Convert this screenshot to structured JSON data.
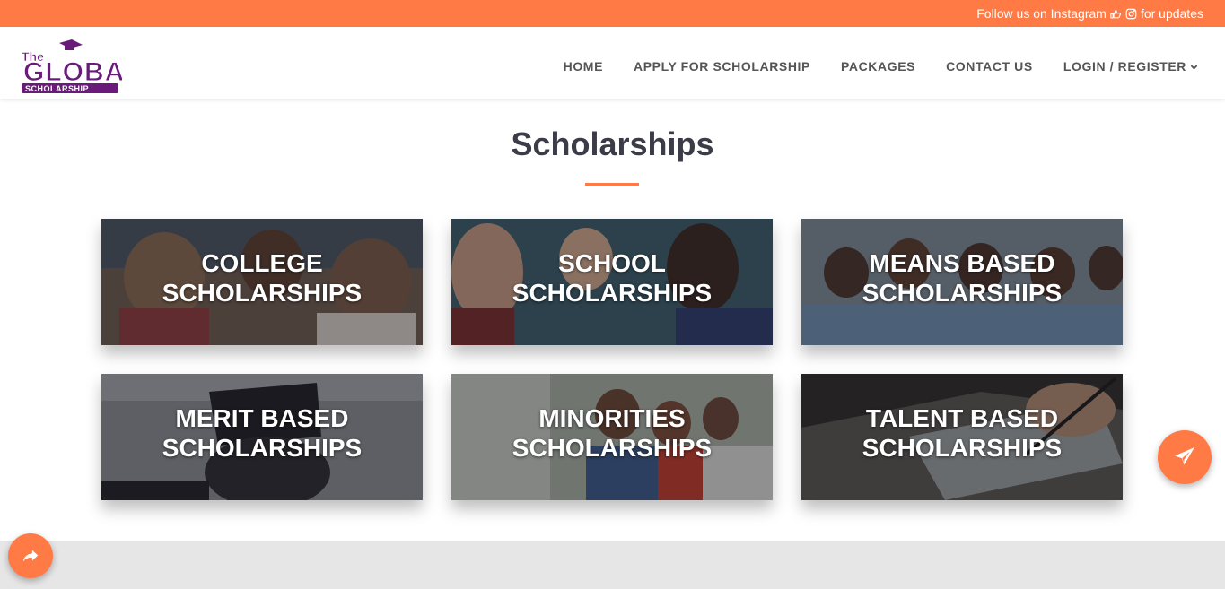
{
  "topbar": {
    "prefix": "Follow us on Instagram",
    "suffix": "for updates",
    "icons": [
      "hand-pointing-icon",
      "instagram-icon"
    ]
  },
  "brand": {
    "logo_icon": "the-global-scholarship-logo",
    "logo_text_line1": "The",
    "logo_text_line2": "GLOBAL",
    "logo_text_line3": "SCHOLARSHIP"
  },
  "nav": {
    "items": [
      {
        "label": "HOME"
      },
      {
        "label": "APPLY FOR SCHOLARSHIP"
      },
      {
        "label": "PACKAGES"
      },
      {
        "label": "CONTACT US"
      },
      {
        "label": "LOGIN / REGISTER",
        "icon": "chevron-down-icon"
      }
    ]
  },
  "main": {
    "title": "Scholarships",
    "cards": [
      {
        "line1": "COLLEGE",
        "line2": "SCHOLARSHIPS"
      },
      {
        "line1": "SCHOOL",
        "line2": "SCHOLARSHIPS"
      },
      {
        "line1": "MEANS BASED",
        "line2": "SCHOLARSHIPS"
      },
      {
        "line1": "MERIT BASED",
        "line2": "SCHOLARSHIPS"
      },
      {
        "line1": "MINORITIES",
        "line2": "SCHOLARSHIPS"
      },
      {
        "line1": "TALENT BASED",
        "line2": "SCHOLARSHIPS"
      }
    ]
  },
  "floating": {
    "send_icon": "paper-plane-icon",
    "share_icon": "share-arrow-icon"
  },
  "colors": {
    "accent": "#ff7a45",
    "brand_purple": "#6a1b7a",
    "heading": "#3c3c48",
    "nav_text": "#555555",
    "footer": "#e6e6e6"
  }
}
